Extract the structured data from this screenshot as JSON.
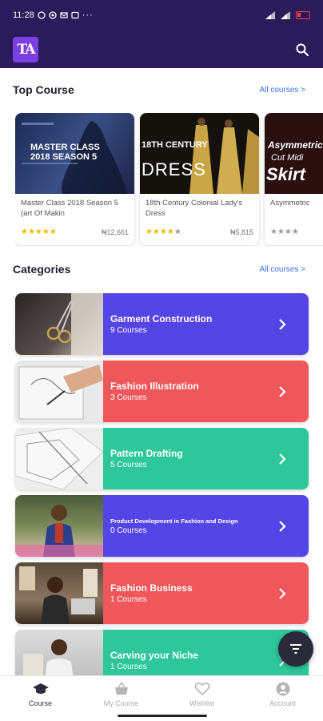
{
  "status": {
    "time": "11:28",
    "battery_color": "#ff3b3b"
  },
  "app_bar": {
    "logo_text": "TA",
    "background": "#2a1c5a",
    "logo_color": "#7b3fe4"
  },
  "top_course": {
    "title": "Top Course",
    "link": "All courses >",
    "courses": [
      {
        "title": "Master Class 2018 Season 5 (art Of Makin",
        "thumb_text": "MASTER CLASS 2018 SEASON 5",
        "rating": 5,
        "price": "₦12,661"
      },
      {
        "title": "18th Century Colonial Lady's Dress",
        "thumb_text_1": "18TH CENTURY",
        "thumb_text_2": "DRESS",
        "rating": 4,
        "price": "₦5,815"
      },
      {
        "title": "Asymmetric",
        "thumb_text_1": "Asymmetric",
        "thumb_text_2": "Cut Midi",
        "thumb_text_3": "Skirt",
        "rating": 0,
        "price": ""
      }
    ]
  },
  "categories": {
    "title": "Categories",
    "link": "All courses >",
    "items": [
      {
        "name": "Garment Construction",
        "count": "9 Courses",
        "color": "#5446e6"
      },
      {
        "name": "Fashion Illustration",
        "count": "3 Courses",
        "color": "#f0575a"
      },
      {
        "name": "Pattern Drafting",
        "count": "5 Courses",
        "color": "#2ec79a"
      },
      {
        "name": "Product Development in Fashion and Design",
        "count": "0 Courses",
        "color": "#5446e6"
      },
      {
        "name": "Fashion Business",
        "count": "1 Courses",
        "color": "#f0575a"
      },
      {
        "name": "Carving your Niche",
        "count": "1 Courses",
        "color": "#2ec79a"
      }
    ]
  },
  "bottom_nav": {
    "items": [
      {
        "label": "Course",
        "icon": "graduation-cap-icon",
        "active": true
      },
      {
        "label": "My Course",
        "icon": "basket-icon",
        "active": false
      },
      {
        "label": "Wishlist",
        "icon": "heart-icon",
        "active": false
      },
      {
        "label": "Account",
        "icon": "user-icon",
        "active": false
      }
    ]
  }
}
